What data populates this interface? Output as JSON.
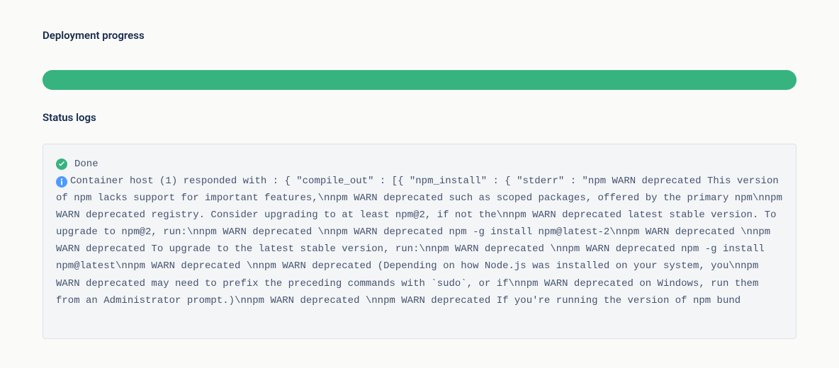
{
  "headings": {
    "progress": "Deployment progress",
    "logs": "Status logs"
  },
  "progress": {
    "percent": 100
  },
  "colors": {
    "accent": "#36b37e",
    "heading": "#172b4d",
    "panel_bg": "#f4f5f7",
    "panel_border": "#dfe1e6",
    "text": "#44546f",
    "icon_success": "#36b37e",
    "icon_info": "#4c9aff"
  },
  "logs": [
    {
      "icon": "check-circle-icon",
      "text": "Done"
    },
    {
      "icon": "info-circle-icon",
      "text": "Container host (1) responded with : { \"compile_out\" : [{ \"npm_install\" : { \"stderr\" : \"npm WARN deprecated This version of npm lacks support for important features,\\nnpm WARN deprecated such as scoped packages, offered by the primary npm\\nnpm WARN deprecated registry. Consider upgrading to at least npm@2, if not the\\nnpm WARN deprecated latest stable version. To upgrade to npm@2, run:\\nnpm WARN deprecated \\nnpm WARN deprecated npm -g install npm@latest-2\\nnpm WARN deprecated \\nnpm WARN deprecated To upgrade to the latest stable version, run:\\nnpm WARN deprecated \\nnpm WARN deprecated npm -g install npm@latest\\nnpm WARN deprecated \\nnpm WARN deprecated (Depending on how Node.js was installed on your system, you\\nnpm WARN deprecated may need to prefix the preceding commands with `sudo`, or if\\nnpm WARN deprecated on Windows, run them from an Administrator prompt.)\\nnpm WARN deprecated \\nnpm WARN deprecated If you're running the version of npm bund"
    }
  ]
}
